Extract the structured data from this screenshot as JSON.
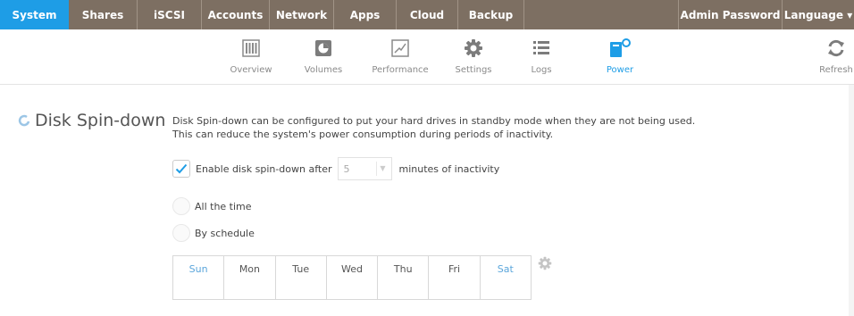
{
  "topnav": {
    "tabs": [
      {
        "label": "System",
        "active": true
      },
      {
        "label": "Shares"
      },
      {
        "label": "iSCSI"
      },
      {
        "label": "Accounts"
      },
      {
        "label": "Network"
      },
      {
        "label": "Apps"
      },
      {
        "label": "Cloud"
      },
      {
        "label": "Backup"
      }
    ],
    "right": [
      {
        "label": "Admin Password"
      },
      {
        "label": "Language ▾"
      }
    ]
  },
  "subbar": {
    "items": [
      {
        "label": "Overview",
        "icon": "overview-icon"
      },
      {
        "label": "Volumes",
        "icon": "volumes-icon"
      },
      {
        "label": "Performance",
        "icon": "performance-icon"
      },
      {
        "label": "Settings",
        "icon": "settings-icon"
      },
      {
        "label": "Logs",
        "icon": "logs-icon"
      },
      {
        "label": "Power",
        "icon": "power-icon",
        "active": true
      }
    ],
    "refresh": {
      "label": "Refresh",
      "icon": "refresh-icon"
    }
  },
  "section": {
    "title": "Disk Spin-down",
    "desc_line1": "Disk Spin-down can be configured to put your hard drives in standby mode when they are not being used.",
    "desc_line2": "This can reduce the system's power consumption during periods of inactivity."
  },
  "spindown": {
    "enable_label": "Enable disk spin-down after",
    "minutes_value": "5",
    "suffix": "minutes of inactivity",
    "checked": true
  },
  "mode": {
    "all_time": "All the time",
    "by_schedule": "By schedule"
  },
  "schedule": {
    "days": [
      "Sun",
      "Mon",
      "Tue",
      "Wed",
      "Thu",
      "Fri",
      "Sat"
    ]
  },
  "colors": {
    "accent": "#1e9de6",
    "nav_bg": "#7d6f62"
  }
}
